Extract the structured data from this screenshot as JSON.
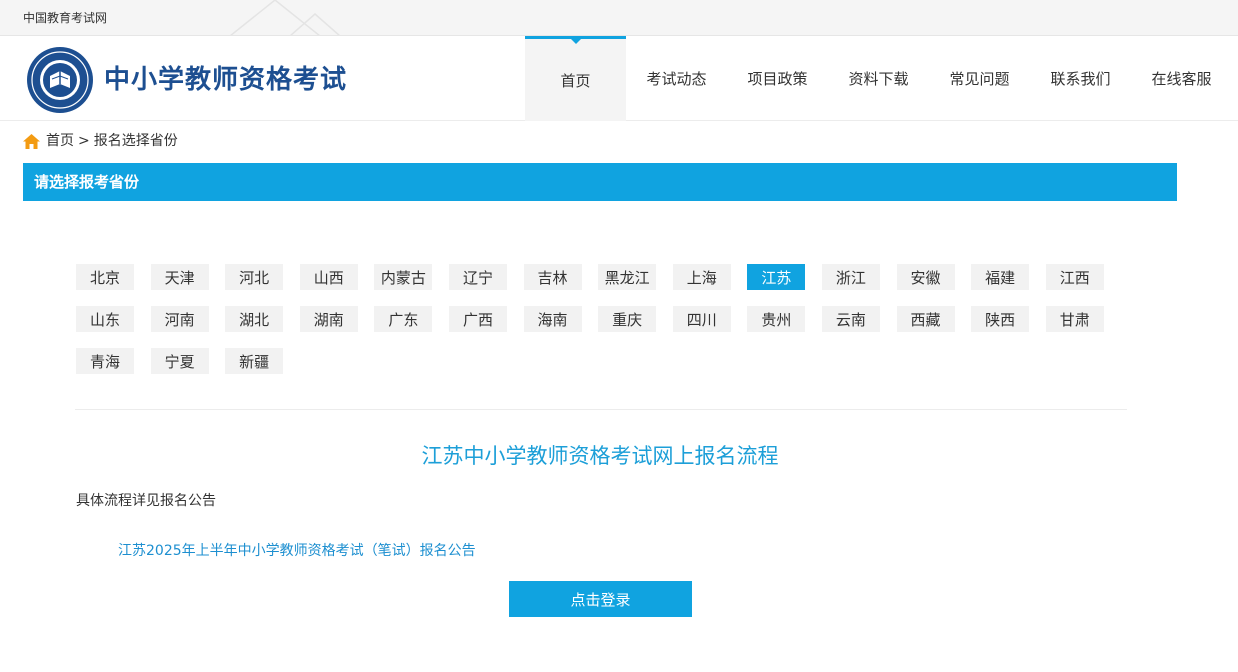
{
  "topbar": {
    "link_text": "中国教育考试网"
  },
  "header": {
    "site_title": "中小学教师资格考试"
  },
  "nav": {
    "items": [
      {
        "label": "首页",
        "active": true
      },
      {
        "label": "考试动态"
      },
      {
        "label": "项目政策"
      },
      {
        "label": "资料下载"
      },
      {
        "label": "常见问题"
      },
      {
        "label": "联系我们"
      },
      {
        "label": "在线客服"
      }
    ]
  },
  "breadcrumb": {
    "home": "首页",
    "separator": ">",
    "current": "报名选择省份"
  },
  "section": {
    "title": "请选择报考省份"
  },
  "provinces": {
    "rows": [
      [
        "北京",
        "天津",
        "河北",
        "山西",
        "内蒙古",
        "辽宁",
        "吉林",
        "黑龙江",
        "上海",
        "江苏",
        "浙江",
        "安徽",
        "福建",
        "江西"
      ],
      [
        "山东",
        "河南",
        "湖北",
        "湖南",
        "广东",
        "广西",
        "海南",
        "重庆",
        "四川",
        "贵州",
        "云南",
        "西藏",
        "陕西",
        "甘肃"
      ],
      [
        "青海",
        "宁夏",
        "新疆"
      ]
    ],
    "selected": "江苏"
  },
  "flow": {
    "title": "江苏中小学教师资格考试网上报名流程",
    "detail": "具体流程详见报名公告",
    "notice_link": "江苏2025年上半年中小学教师资格考试（笔试）报名公告",
    "login_button": "点击登录"
  },
  "colors": {
    "accent": "#10a3e0",
    "brand": "#1d4f91",
    "link": "#1d8fd0"
  }
}
